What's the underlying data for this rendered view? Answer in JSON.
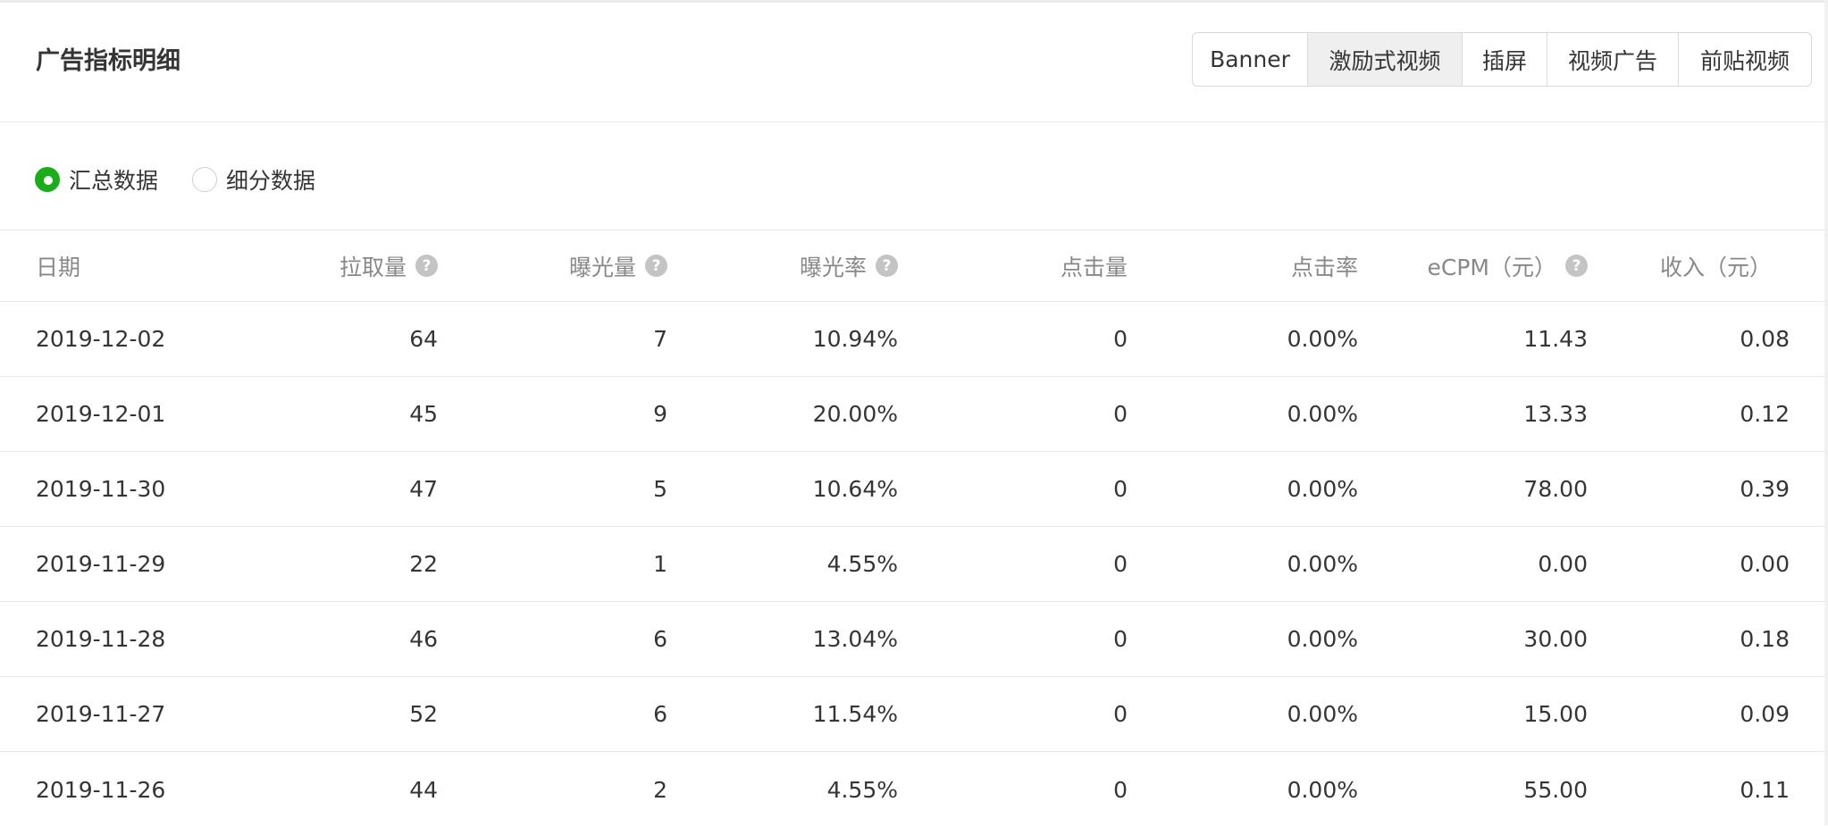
{
  "page": {
    "title": "广告指标明细"
  },
  "ad_type_tabs": [
    {
      "label": "Banner",
      "active": false
    },
    {
      "label": "激励式视频",
      "active": true
    },
    {
      "label": "插屏",
      "active": false
    },
    {
      "label": "视频广告",
      "active": false
    },
    {
      "label": "前贴视频",
      "active": false
    }
  ],
  "data_mode": {
    "options": [
      {
        "label": "汇总数据",
        "checked": true
      },
      {
        "label": "细分数据",
        "checked": false
      }
    ]
  },
  "table": {
    "headers": [
      {
        "label": "日期",
        "help": false
      },
      {
        "label": "拉取量",
        "help": true
      },
      {
        "label": "曝光量",
        "help": true
      },
      {
        "label": "曝光率",
        "help": true
      },
      {
        "label": "点击量",
        "help": false
      },
      {
        "label": "点击率",
        "help": false
      },
      {
        "label": "eCPM（元）",
        "help": true
      },
      {
        "label": "收入（元）",
        "help": false
      }
    ],
    "rows": [
      [
        "2019-12-02",
        "64",
        "7",
        "10.94%",
        "0",
        "0.00%",
        "11.43",
        "0.08"
      ],
      [
        "2019-12-01",
        "45",
        "9",
        "20.00%",
        "0",
        "0.00%",
        "13.33",
        "0.12"
      ],
      [
        "2019-11-30",
        "47",
        "5",
        "10.64%",
        "0",
        "0.00%",
        "78.00",
        "0.39"
      ],
      [
        "2019-11-29",
        "22",
        "1",
        "4.55%",
        "0",
        "0.00%",
        "0.00",
        "0.00"
      ],
      [
        "2019-11-28",
        "46",
        "6",
        "13.04%",
        "0",
        "0.00%",
        "30.00",
        "0.18"
      ],
      [
        "2019-11-27",
        "52",
        "6",
        "11.54%",
        "0",
        "0.00%",
        "15.00",
        "0.09"
      ],
      [
        "2019-11-26",
        "44",
        "2",
        "4.55%",
        "0",
        "0.00%",
        "55.00",
        "0.11"
      ]
    ]
  },
  "icons": {
    "help": "question-circle-icon",
    "help_glyph": "?"
  },
  "colors": {
    "accent": "#1aad19",
    "text": "#353535",
    "muted": "#888888",
    "border": "#e7e7e7",
    "active_tab_bg": "#efefef"
  }
}
